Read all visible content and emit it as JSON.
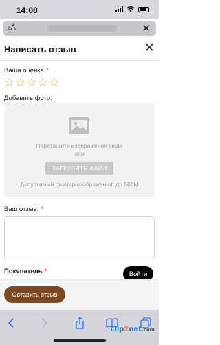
{
  "status_bar": {
    "time": "14:08"
  },
  "url_bar": {
    "aa_small": "a",
    "aa_large": "A"
  },
  "modal": {
    "title": "Написать отзыв",
    "rating_label": "Ваша оценка",
    "required_mark": "*",
    "stars": [
      {
        "name": "star-1"
      },
      {
        "name": "star-2"
      },
      {
        "name": "star-3"
      },
      {
        "name": "star-4"
      },
      {
        "name": "star-5"
      }
    ],
    "star_glyph": "☆",
    "add_photo_label": "Добавить фото:",
    "dropzone": {
      "drag_text": "Перетащите изображения сюда",
      "or_text": "или",
      "upload_button": "ЗАГРУЗИТЬ ФАЙЛ",
      "size_hint": "Допустимый размер изображения: до 500М"
    },
    "review_label": "Ваш отзыв:",
    "review_value": "",
    "next_field_label_partial": "Покупатель",
    "login_button": "Войти",
    "submit_button": "Оставить отзыв"
  },
  "toolbar": {
    "icons": [
      "back-icon",
      "forward-icon",
      "share-icon",
      "bookmarks-icon",
      "tabs-icon"
    ]
  },
  "watermark": {
    "part1": "clip",
    "part2": "2",
    "part3": "net",
    "suffix": ".com"
  },
  "colors": {
    "accent_brown": "#7b4a25",
    "star_gold": "#c9a24a",
    "required_red": "#dd3333",
    "ios_blue": "#3478f6"
  }
}
